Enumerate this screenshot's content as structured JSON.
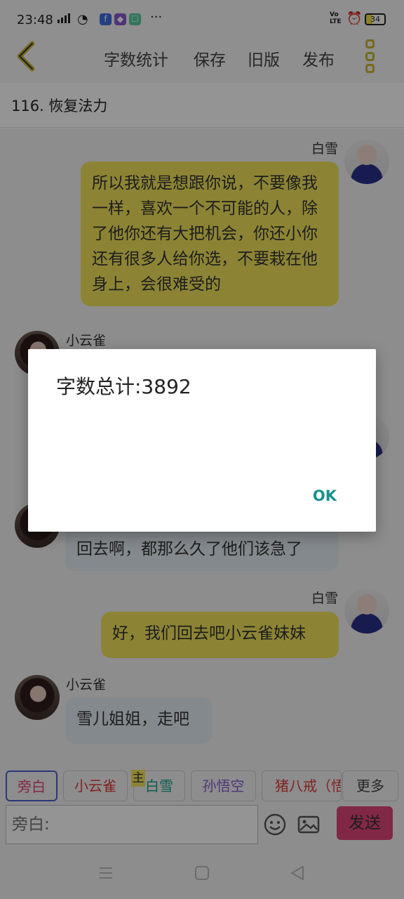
{
  "status_bar": {
    "time": "23:48",
    "network_label": "Vo\nLTE",
    "battery": "34",
    "more": "···"
  },
  "toolbar": {
    "word_count": "字数统计",
    "save": "保存",
    "old_version": "旧版",
    "publish": "发布"
  },
  "chapter": {
    "title": "116. 恢复法力"
  },
  "messages": [
    {
      "speaker": "白雪",
      "side": "right",
      "text": "所以我就是想跟你说，不要像我一样，喜欢一个不可能的人，除了他你还有大把机会，你还小你还有很多人给你选，不要栽在他身上，会很难受的"
    },
    {
      "speaker": "小云雀",
      "side": "left",
      "text": ""
    },
    {
      "speaker": "",
      "side": "left",
      "text": "回去啊，都那么久了他们该急了"
    },
    {
      "speaker": "白雪",
      "side": "right",
      "text": "好，我们回去吧小云雀妹妹"
    },
    {
      "speaker": "小云雀",
      "side": "left",
      "text": "雪儿姐姐，走吧"
    }
  ],
  "dialog": {
    "message": "字数总计:3892",
    "ok": "OK"
  },
  "roles": {
    "items": [
      {
        "label": "旁白",
        "color": "#e0457a"
      },
      {
        "label": "小云雀",
        "color": "#e03a3a"
      },
      {
        "label": "白雪",
        "color": "#1aa38a"
      },
      {
        "label": "孙悟空",
        "color": "#8a5ad0"
      },
      {
        "label": "猪八戒（悟",
        "color": "#e03a3a"
      },
      {
        "label": "更多",
        "color": "#444444"
      }
    ],
    "main_badge": "主"
  },
  "input": {
    "placeholder": "旁白:",
    "send": "发送"
  },
  "icons": [
    "back-arrow-icon",
    "kebab-menu-icon",
    "emoji-icon",
    "image-icon",
    "menu-nav-icon",
    "home-nav-icon",
    "back-nav-icon"
  ]
}
